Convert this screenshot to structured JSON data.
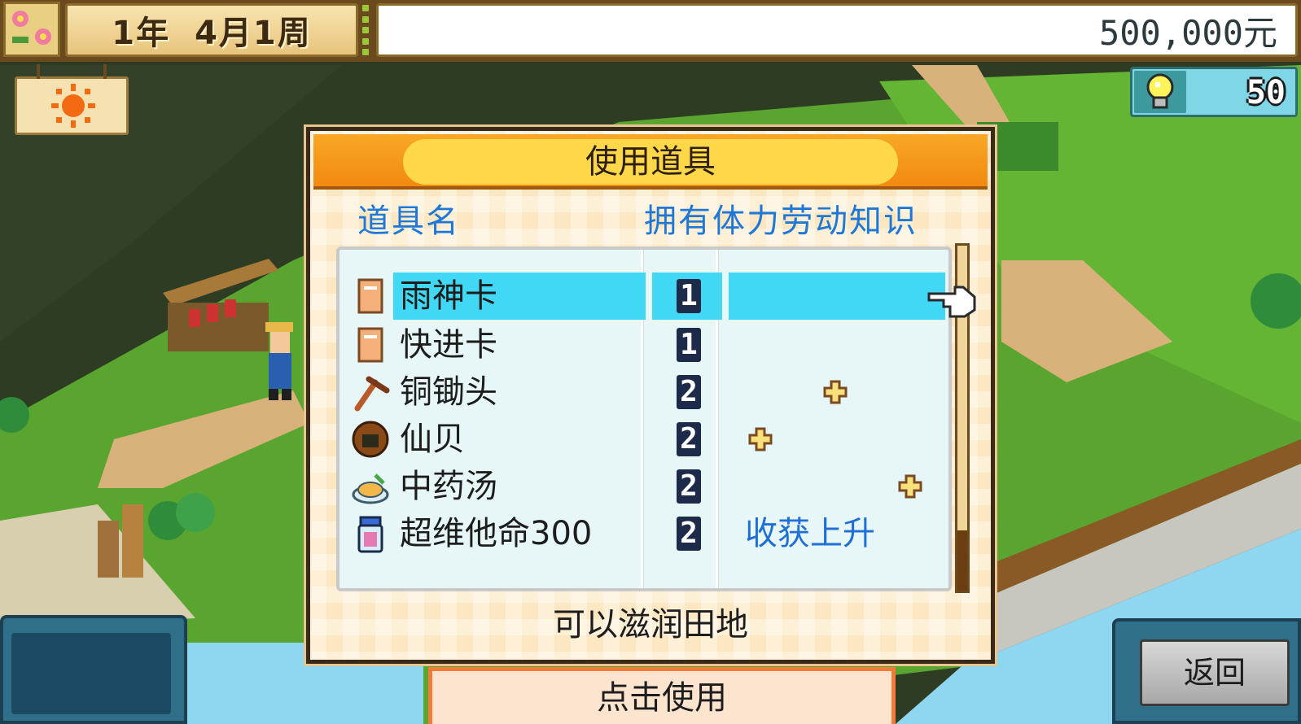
{
  "hud": {
    "year": "1年",
    "month_week": "4月1周",
    "money": "500,000元",
    "ideas": "50"
  },
  "dialog": {
    "title": "使用道具",
    "col_name": "道具名",
    "col_stats": "拥有体力劳动知识",
    "items": [
      {
        "name": "雨神卡",
        "owned": "1",
        "effect": "",
        "icon": "card-icon"
      },
      {
        "name": "快进卡",
        "owned": "1",
        "effect": "",
        "icon": "card-icon"
      },
      {
        "name": "铜锄头",
        "owned": "2",
        "effect": "",
        "icon": "hoe-icon"
      },
      {
        "name": "仙贝",
        "owned": "2",
        "effect": "",
        "icon": "rice-cracker-icon"
      },
      {
        "name": "中药汤",
        "owned": "2",
        "effect": "",
        "icon": "herbal-soup-icon"
      },
      {
        "name": "超维他命300",
        "owned": "2",
        "effect": "收获上升",
        "icon": "vitamin-bottle-icon"
      }
    ],
    "description": "可以滋润田地"
  },
  "buttons": {
    "use": "点击使用",
    "back": "返回"
  },
  "colors": {
    "header_orange": "#f9a726",
    "header_pill": "#ffd84a",
    "highlight": "#40d8f4",
    "stat_blue": "#1f78d6",
    "grass": "#5aa52f"
  }
}
